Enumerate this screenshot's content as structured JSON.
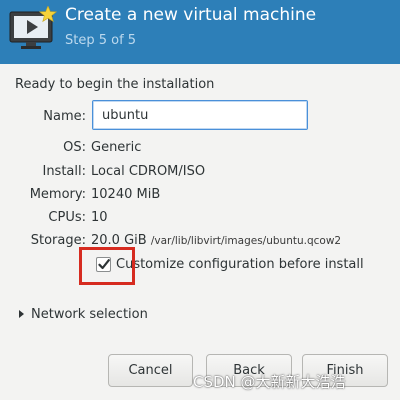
{
  "header": {
    "title": "Create a new virtual machine",
    "step": "Step 5 of 5",
    "icon": "monitor-play-star-icon"
  },
  "section_title": "Ready to begin the installation",
  "form": {
    "name_label": "Name:",
    "name_value": "ubuntu",
    "os_label": "OS:",
    "os_value": "Generic",
    "install_label": "Install:",
    "install_value": "Local CDROM/ISO",
    "memory_label": "Memory:",
    "memory_value": "10240 MiB",
    "cpus_label": "CPUs:",
    "cpus_value": "10",
    "storage_label": "Storage:",
    "storage_size": "20.0 GiB",
    "storage_path": "/var/lib/libvirt/images/ubuntu.qcow2"
  },
  "customize": {
    "label": "Customize configuration before install",
    "checked": true
  },
  "network": {
    "label": "Network selection",
    "expanded": false
  },
  "buttons": {
    "cancel": "Cancel",
    "back": "Back",
    "finish": "Finish"
  },
  "watermark": "CSDN @大新新大浩浩",
  "colors": {
    "header_bg": "#2d7fb8",
    "highlight_border": "#d62b20",
    "window_bg": "#f3f3f2"
  }
}
